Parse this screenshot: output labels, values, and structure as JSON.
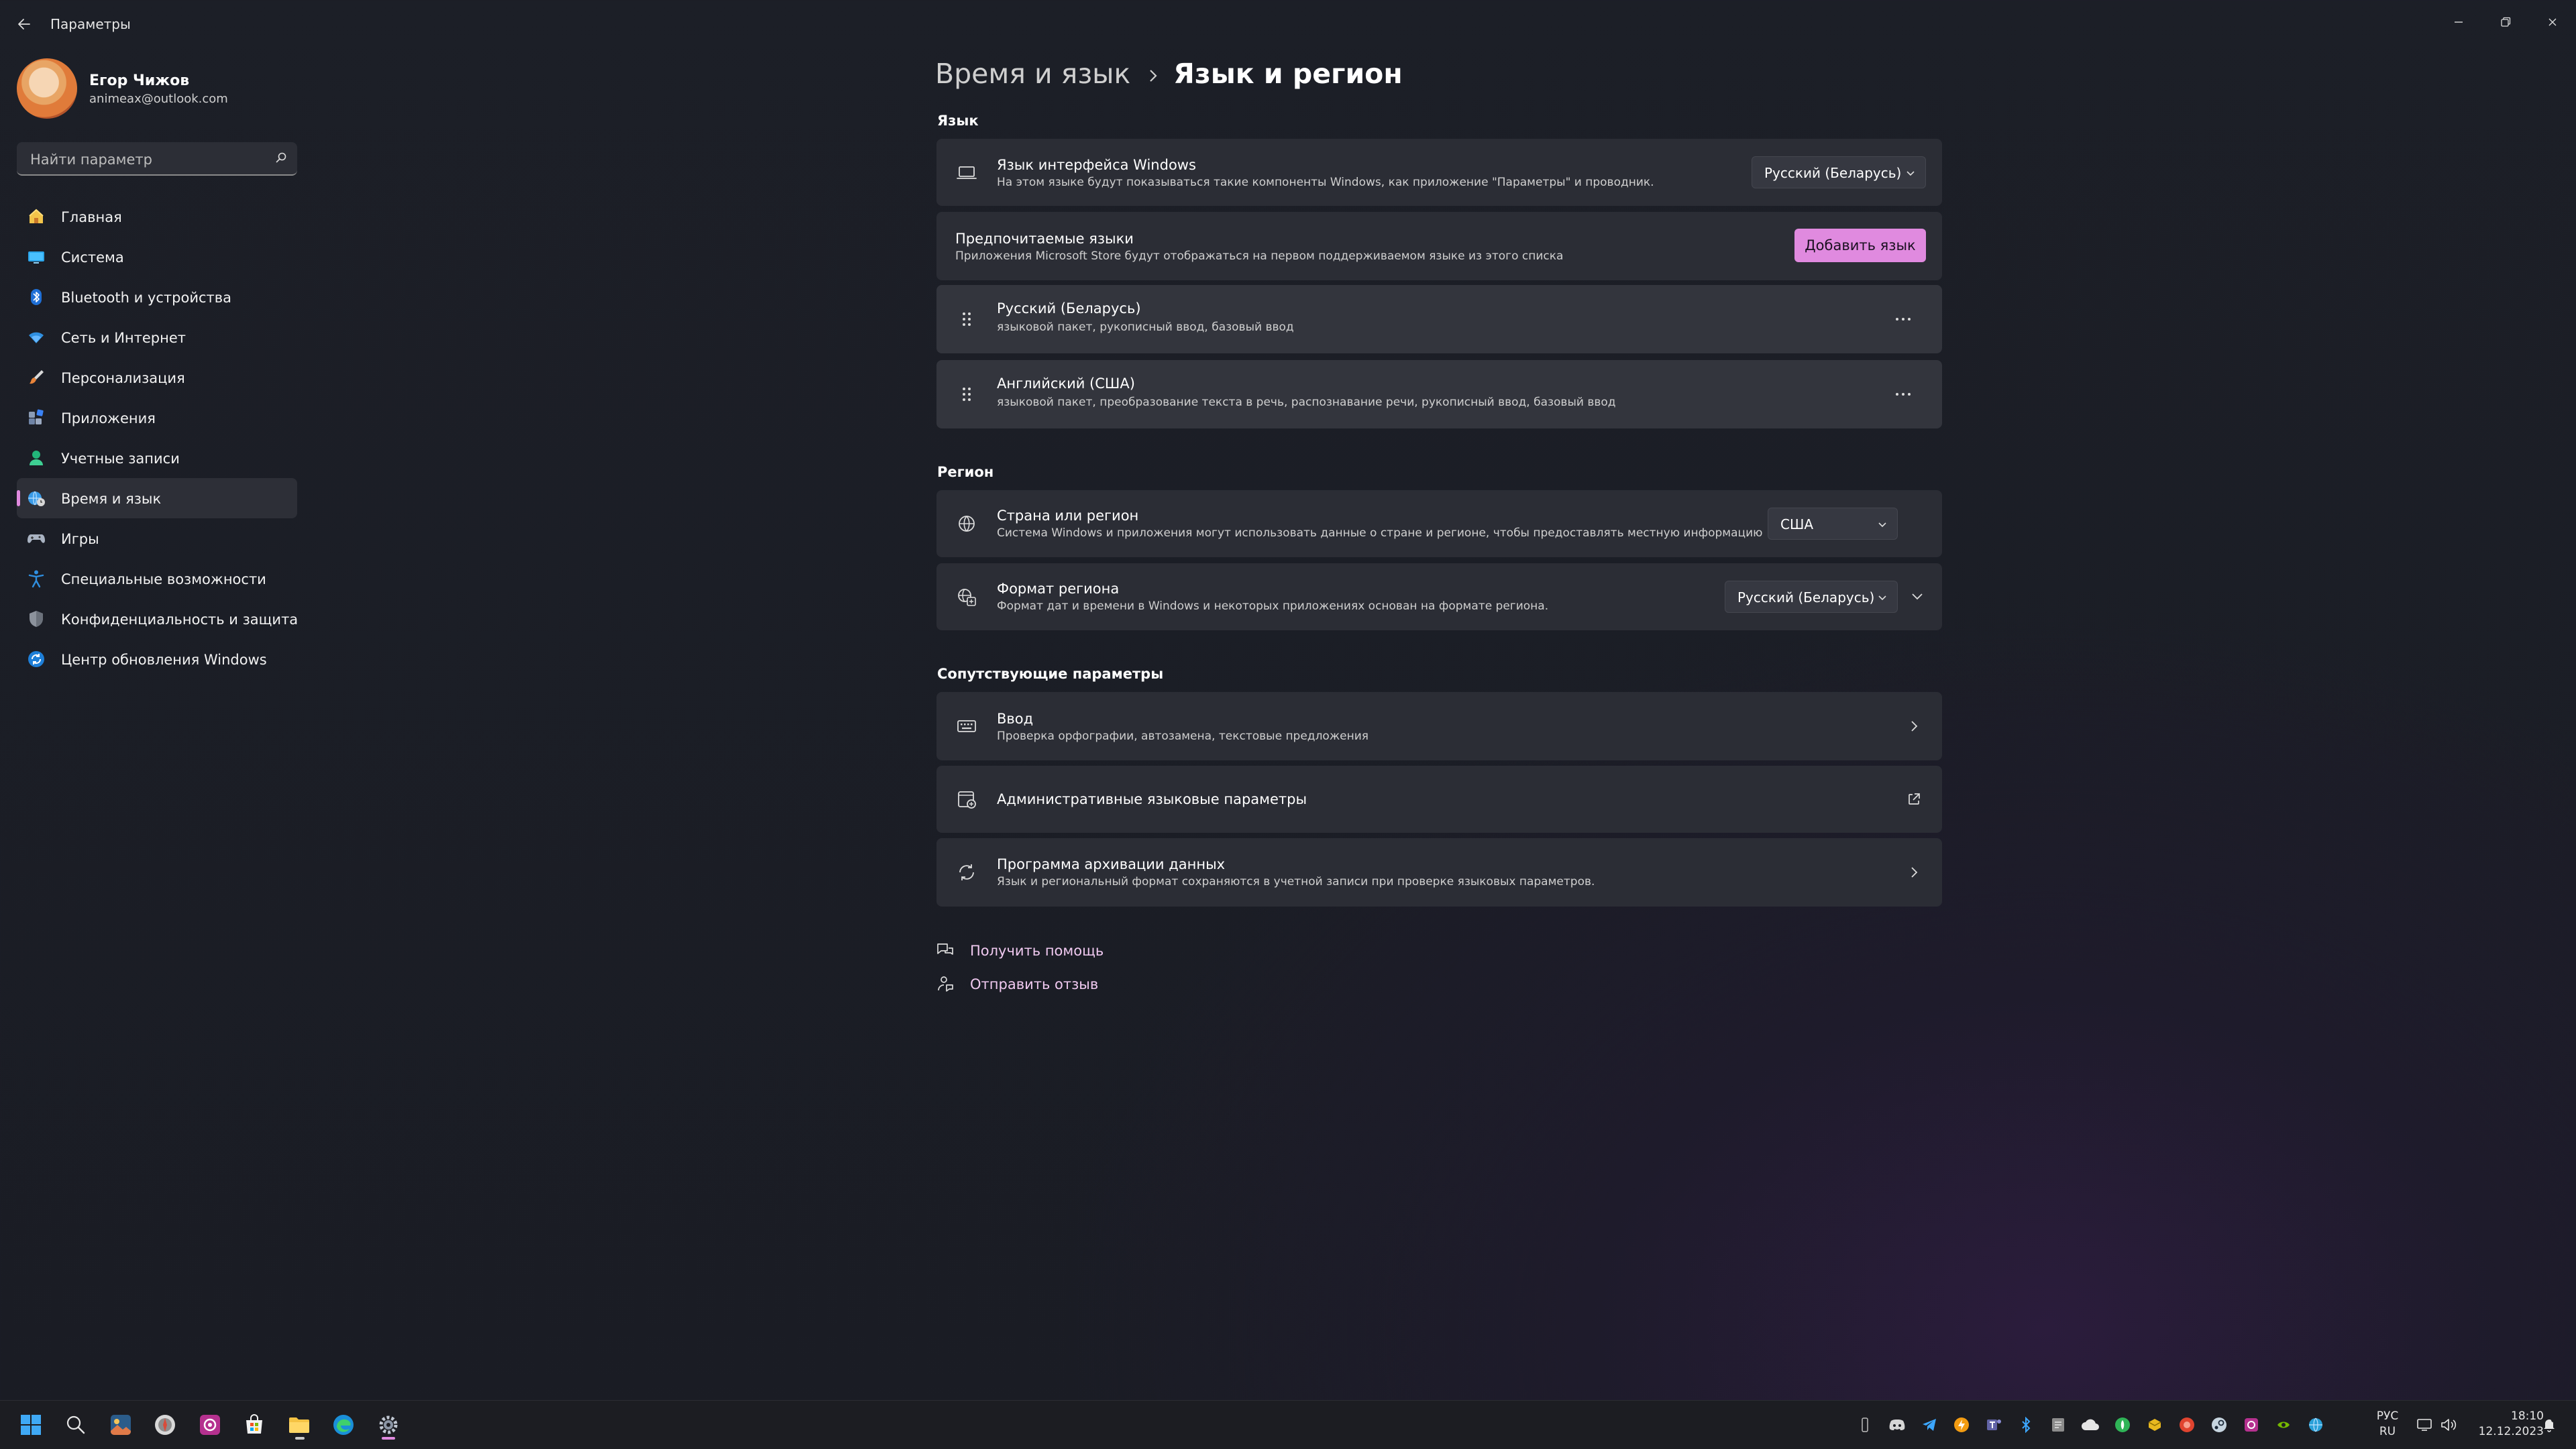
{
  "window": {
    "title": "Параметры"
  },
  "user": {
    "name": "Егор Чижов",
    "email": "animeax@outlook.com"
  },
  "search": {
    "placeholder": "Найти параметр"
  },
  "sidebar": {
    "items": [
      {
        "label": "Главная",
        "icon": "home-icon"
      },
      {
        "label": "Система",
        "icon": "display-icon"
      },
      {
        "label": "Bluetooth и устройства",
        "icon": "bluetooth-icon"
      },
      {
        "label": "Сеть и Интернет",
        "icon": "wifi-icon"
      },
      {
        "label": "Персонализация",
        "icon": "brush-icon"
      },
      {
        "label": "Приложения",
        "icon": "apps-icon"
      },
      {
        "label": "Учетные записи",
        "icon": "person-icon"
      },
      {
        "label": "Время и язык",
        "icon": "time-language-icon",
        "active": true
      },
      {
        "label": "Игры",
        "icon": "gamepad-icon"
      },
      {
        "label": "Специальные возможности",
        "icon": "accessibility-icon"
      },
      {
        "label": "Конфиденциальность и защита",
        "icon": "shield-icon"
      },
      {
        "label": "Центр обновления Windows",
        "icon": "update-icon"
      }
    ]
  },
  "breadcrumb": {
    "parent": "Время и язык",
    "current": "Язык и регион"
  },
  "language_section": {
    "heading": "Язык",
    "display_language": {
      "title": "Язык интерфейса Windows",
      "subtitle": "На этом языке будут показываться такие компоненты Windows, как приложение \"Параметры\" и проводник.",
      "value": "Русский (Беларусь)"
    },
    "preferred": {
      "title": "Предпочитаемые языки",
      "subtitle": "Приложения Microsoft Store будут отображаться на первом поддерживаемом языке из этого списка",
      "add_button": "Добавить язык"
    },
    "languages": [
      {
        "name": "Русский (Беларусь)",
        "features": "языковой пакет, рукописный ввод, базовый ввод"
      },
      {
        "name": "Английский (США)",
        "features": "языковой пакет, преобразование текста в речь, распознавание речи, рукописный ввод, базовый ввод"
      }
    ]
  },
  "region_section": {
    "heading": "Регион",
    "country": {
      "title": "Страна или регион",
      "subtitle": "Система Windows и приложения могут использовать данные о стране и регионе, чтобы предоставлять местную информацию",
      "value": "США"
    },
    "format": {
      "title": "Формат региона",
      "subtitle": "Формат дат и времени в Windows и некоторых приложениях основан на формате региона.",
      "value": "Русский (Беларусь)"
    }
  },
  "related_section": {
    "heading": "Сопутствующие параметры",
    "typing": {
      "title": "Ввод",
      "subtitle": "Проверка орфографии, автозамена, текстовые предложения"
    },
    "admin": {
      "title": "Административные языковые параметры"
    },
    "backup": {
      "title": "Программа архивации данных",
      "subtitle": "Язык и региональный формат сохраняются в учетной записи при проверке языковых параметров."
    }
  },
  "help_links": {
    "get_help": "Получить помощь",
    "feedback": "Отправить отзыв"
  },
  "taskbar": {
    "input_lang_line1": "РУС",
    "input_lang_line2": "RU",
    "time": "18:10",
    "date": "12.12.2023"
  },
  "colors": {
    "accent": "#e08adf",
    "card": "#2b2d35",
    "background": "#1c1f27"
  }
}
